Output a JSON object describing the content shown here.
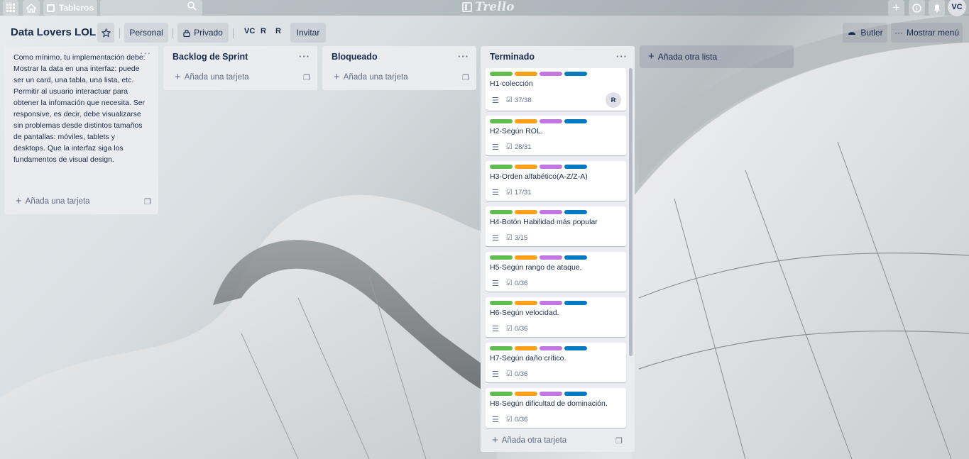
{
  "topbar": {
    "boards_label": "Tableros",
    "search_value": "",
    "search_placeholder": "",
    "logo_text": "Trello",
    "user_initials": "VC"
  },
  "board": {
    "title": "Data Lovers LOL",
    "team_label": "Personal",
    "visibility_label": "Privado",
    "members": [
      "VC",
      "R",
      "R"
    ],
    "invite_label": "Invitar",
    "butler_label": "Butler",
    "menu_label": "Mostrar menú"
  },
  "lists": [
    {
      "title": "",
      "description": "Como mínimo, tu implementación debe:  Mostrar la data en una interfaz: puede ser un card, una tabla, una lista, etc. Permitir al usuario interactuar para obtener la infomación que necesita. Ser responsive, es decir, debe visualizarse sin problemas desde distintos tamaños de pantallas: móviles, tablets y desktops. Que la interfaz siga los fundamentos de visual design.",
      "add_label": "Añada una tarjeta"
    },
    {
      "title": "Backlog de Sprint",
      "add_label": "Añada una tarjeta"
    },
    {
      "title": "Bloqueado",
      "add_label": "Añada una tarjeta"
    },
    {
      "title": "Terminado",
      "add_label": "Añada otra tarjeta",
      "cards": [
        {
          "title": "H1-colección",
          "checklist": "37/38",
          "member": "R"
        },
        {
          "title": "H2-Según ROL.",
          "checklist": "28/31"
        },
        {
          "title": "H3-Orden alfabético(A-Z/Z-A)",
          "checklist": "17/31"
        },
        {
          "title": "H4-Botón Habilidad más popular",
          "checklist": "3/15"
        },
        {
          "title": "H5-Según rango de ataque.",
          "checklist": "0/36"
        },
        {
          "title": "H6-Según velocidad.",
          "checklist": "0/36"
        },
        {
          "title": "H7-Según daño crítico.",
          "checklist": "0/36"
        },
        {
          "title": "H8-Según dificultad de dominación.",
          "checklist": "0/36"
        }
      ]
    }
  ],
  "add_list_label": "Añada otra lista",
  "label_colors": [
    "#61bd4f",
    "#ff9f1a",
    "#c377e0",
    "#0079bf"
  ]
}
